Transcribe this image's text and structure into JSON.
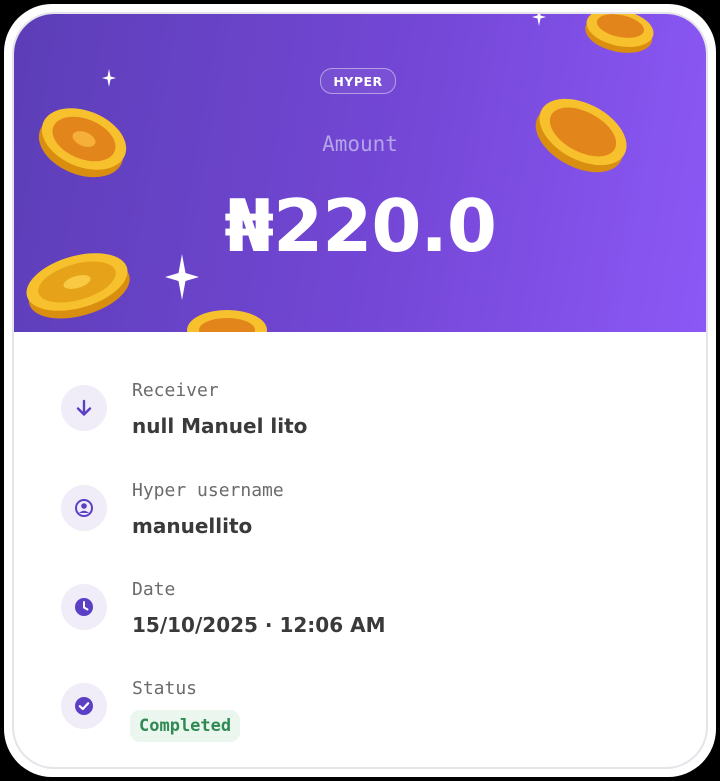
{
  "brand": {
    "logo_text": "HYPER",
    "accent": "#7447d6"
  },
  "amount": {
    "label": "Amount",
    "value": "₦220.0"
  },
  "details": {
    "receiver": {
      "label": "Receiver",
      "value": "null Manuel lito",
      "icon": "arrow-down-icon"
    },
    "username": {
      "label": "Hyper username",
      "value": "manuellito",
      "icon": "user-circle-icon"
    },
    "date": {
      "label": "Date",
      "value": "15/10/2025 · 12:06 AM",
      "icon": "clock-icon"
    },
    "status": {
      "label": "Status",
      "value": "Completed",
      "icon": "check-circle-icon",
      "color": "#2e8a52"
    }
  }
}
